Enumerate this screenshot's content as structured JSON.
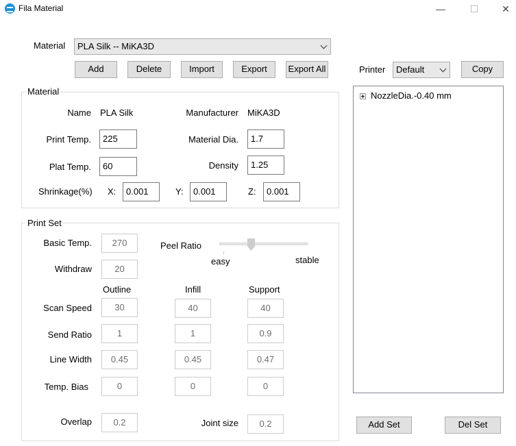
{
  "window": {
    "title": "Fila Material",
    "minimize": "—",
    "maximize": "☐",
    "close": "✕"
  },
  "material_select": {
    "label": "Material",
    "value": "PLA Silk -- MiKA3D"
  },
  "actions": {
    "add": "Add",
    "delete": "Delete",
    "import": "Import",
    "export": "Export",
    "export_all": "Export All"
  },
  "printer": {
    "label": "Printer",
    "value": "Default",
    "copy": "Copy"
  },
  "material_group": {
    "title": "Material",
    "name_label": "Name",
    "name_value": "PLA Silk",
    "manufacturer_label": "Manufacturer",
    "manufacturer_value": "MiKA3D",
    "print_temp_label": "Print Temp.",
    "print_temp_value": "225",
    "material_dia_label": "Material Dia.",
    "material_dia_value": "1.7",
    "plat_temp_label": "Plat Temp.",
    "plat_temp_value": "60",
    "density_label": "Density",
    "density_value": "1.25",
    "shrinkage_label": "Shrinkage(%)",
    "x_label": "X:",
    "x_value": "0.001",
    "y_label": "Y:",
    "y_value": "0.001",
    "z_label": "Z:",
    "z_value": "0.001"
  },
  "print_set": {
    "title": "Print Set",
    "basic_temp_label": "Basic Temp.",
    "basic_temp_value": "270",
    "withdraw_label": "Withdraw",
    "withdraw_value": "20",
    "peel_ratio_label": "Peel Ratio",
    "peel_easy": "easy",
    "peel_stable": "stable",
    "col_outline": "Outline",
    "col_infill": "Infill",
    "col_support": "Support",
    "scan_speed_label": "Scan Speed",
    "scan_speed": [
      "30",
      "40",
      "40"
    ],
    "send_ratio_label": "Send Ratio",
    "send_ratio": [
      "1",
      "1",
      "0.9"
    ],
    "line_width_label": "Line Width",
    "line_width": [
      "0.45",
      "0.45",
      "0.47"
    ],
    "temp_bias_label": "Temp. Bias",
    "temp_bias": [
      "0",
      "0",
      "0"
    ],
    "overlap_label": "Overlap",
    "overlap_value": "0.2",
    "joint_size_label": "Joint size",
    "joint_size_value": "0.2"
  },
  "tree": {
    "items": [
      {
        "label": "NozzleDia.-0.40 mm"
      }
    ]
  },
  "set_buttons": {
    "add_set": "Add Set",
    "del_set": "Del Set"
  }
}
